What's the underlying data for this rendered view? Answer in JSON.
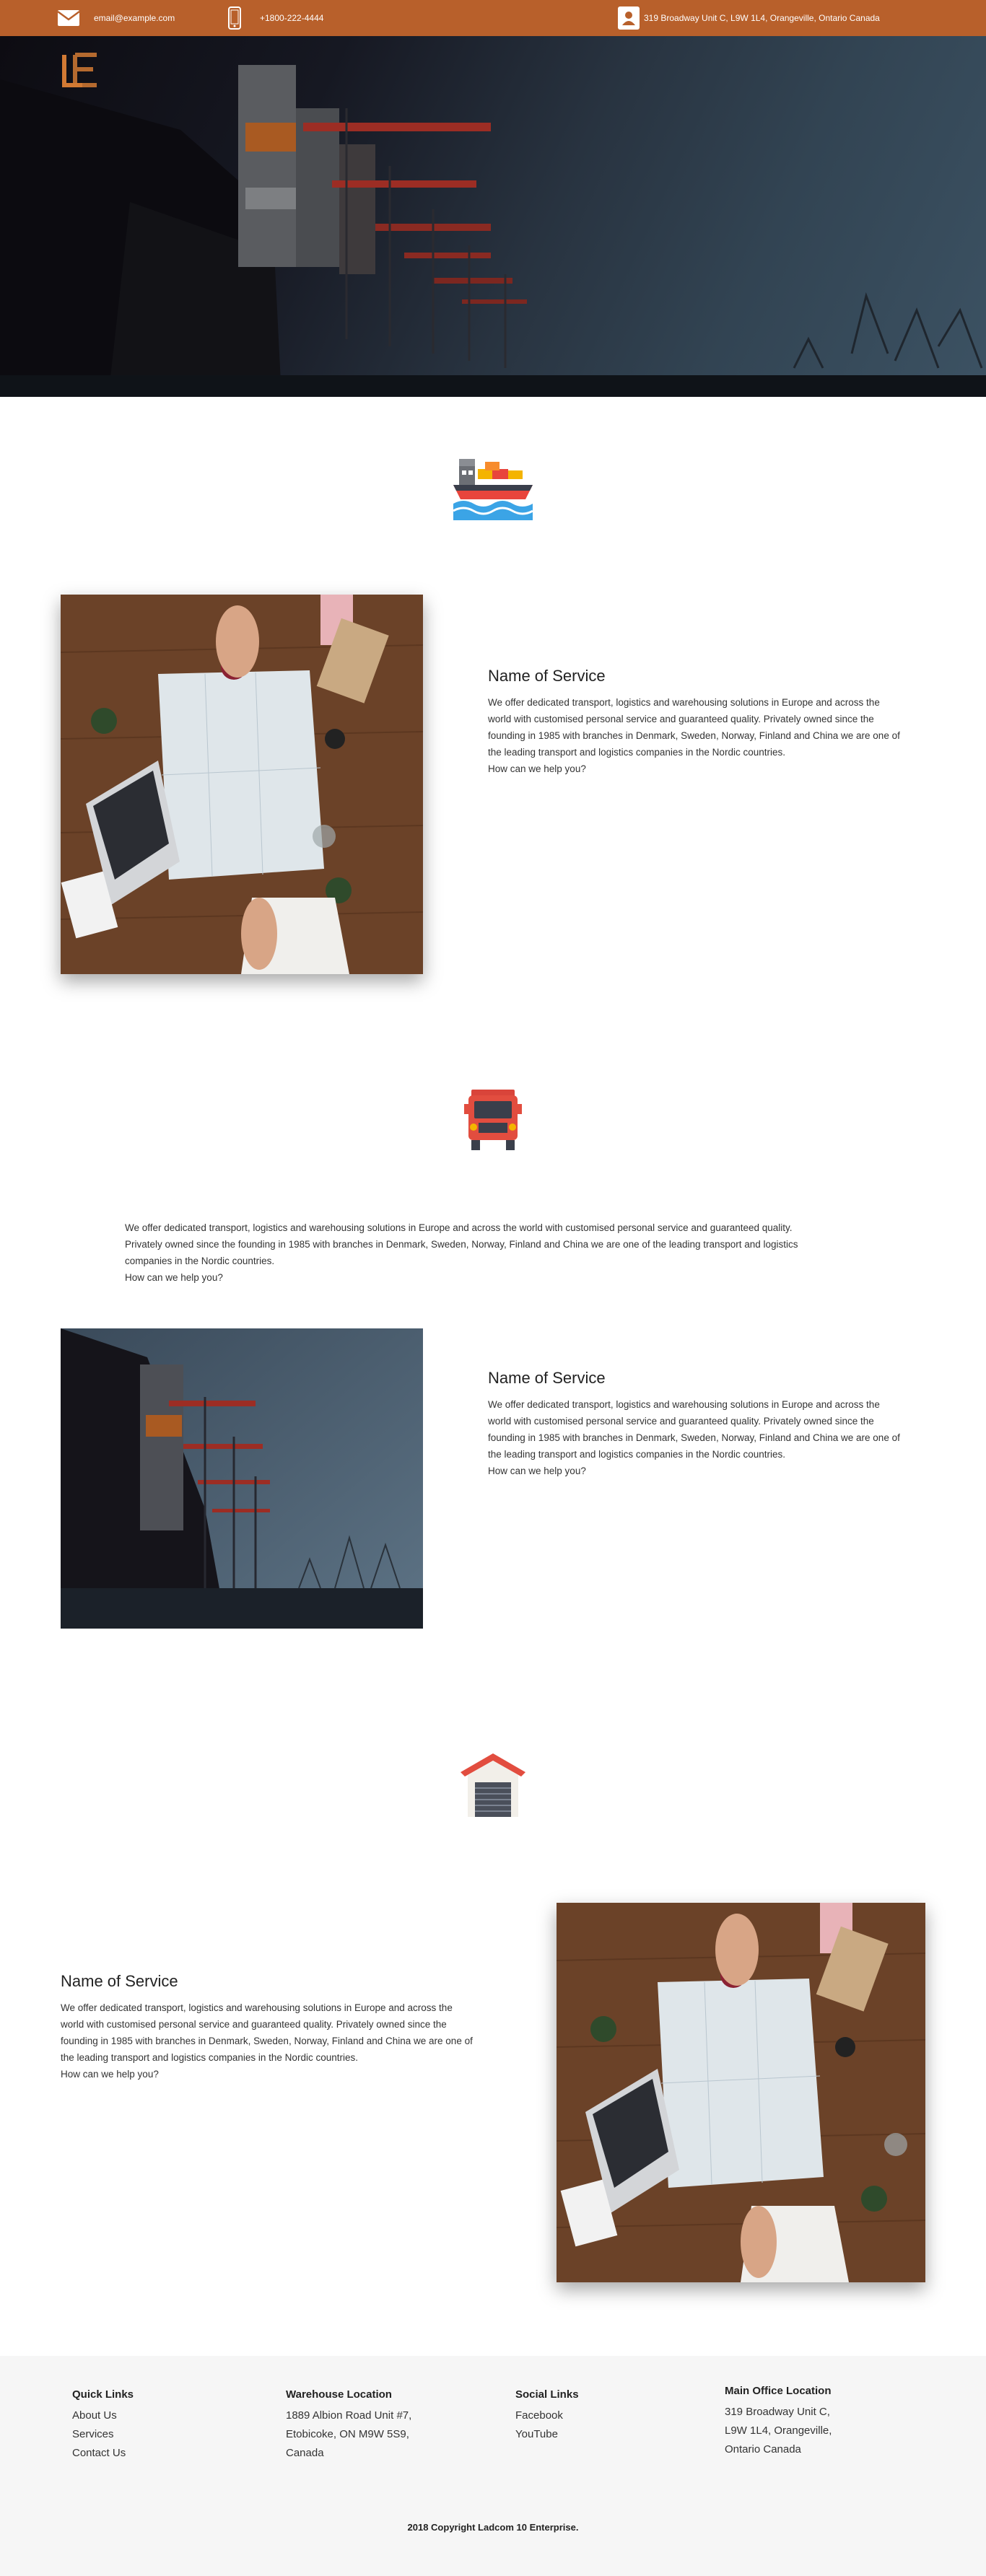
{
  "topbar": {
    "email": "email@example.com",
    "phone": "+1800-222-4444",
    "address": "319 Broadway Unit C, L9W 1L4, Orangeville, Ontario Canada",
    "email_icon": "envelope-icon",
    "phone_icon": "mobile-phone-icon",
    "address_icon": "contact-card-icon"
  },
  "hero": {
    "logo_text": "LE",
    "logo_icon": "company-logo"
  },
  "sections": [
    {
      "icon": "ship-icon",
      "title": "Name of Service",
      "body": "We offer dedicated transport, logistics and warehousing solutions in Europe and across the world with customised personal service and guaranteed quality. Privately owned since the founding in 1985 with branches in Denmark, Sweden, Norway, Finland and China we are one of the leading transport and logistics companies in the Nordic countries.",
      "help": "How can we help you?"
    },
    {
      "icon": "truck-icon",
      "intro": "We offer dedicated transport, logistics and warehousing solutions in Europe and across the world with customised personal service and guaranteed quality. Privately owned since the founding in 1985 with branches in Denmark, Sweden, Norway, Finland and China we are one of the leading transport and logistics companies in the Nordic countries.",
      "intro_help": "How can we help you?",
      "title": "Name of Service",
      "body": "We offer dedicated transport, logistics and warehousing solutions in Europe and across the world with customised personal service and guaranteed quality. Privately owned since the founding in 1985 with branches in Denmark, Sweden, Norway, Finland and China we are one of the leading transport and logistics companies in the Nordic countries.",
      "help": "How can we help you?"
    },
    {
      "icon": "warehouse-icon",
      "title": "Name of Service",
      "body": "We offer dedicated transport, logistics and warehousing solutions in Europe and across the world with customised personal service and guaranteed quality. Privately owned since the founding in 1985 with branches in Denmark, Sweden, Norway, Finland and China we are one of the leading transport and logistics companies in the Nordic countries.",
      "help": "How can we help you?"
    }
  ],
  "footer": {
    "quick_links": {
      "heading": "Quick Links",
      "items": [
        "About Us",
        "Services",
        "Contact Us"
      ]
    },
    "warehouse": {
      "heading": "Warehouse Location",
      "lines": [
        "1889 Albion Road Unit #7,",
        "Etobicoke, ON M9W 5S9,",
        "Canada"
      ]
    },
    "social": {
      "heading": "Social Links",
      "items": [
        "Facebook",
        "YouTube"
      ]
    },
    "main_office": {
      "heading": "Main Office Location",
      "lines": [
        "319 Broadway Unit C,",
        "L9W 1L4, Orangeville,",
        "Ontario Canada"
      ]
    },
    "copyright": "2018 Copyright Ladcom 10 Enterprise."
  },
  "colors": {
    "brand": "#b8602b",
    "footer_bg": "#f6f6f6"
  }
}
